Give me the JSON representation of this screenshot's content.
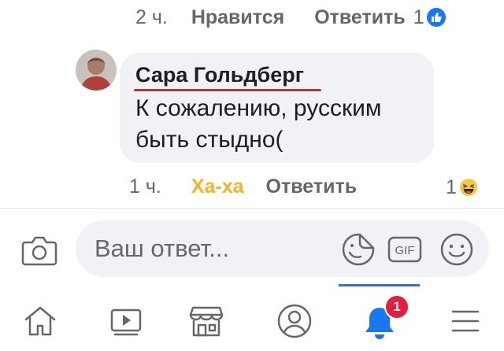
{
  "top_actions": {
    "time": "2 ч.",
    "like_label": "Нравится",
    "reply_label": "Ответить",
    "reaction_count": "1",
    "reaction_icon": "like-icon",
    "accent_color": "#1877f2"
  },
  "comment": {
    "author": "Сара Гольдберг",
    "text": "К сожалению, русским быть стыдно(",
    "avatar_icon": "avatar-photo"
  },
  "comment_actions": {
    "time": "1 ч.",
    "reaction_label": "Ха-ха",
    "reply_label": "Ответить",
    "reaction_count": "1",
    "reaction_icon": "haha-icon",
    "reaction_color": "#f7b125"
  },
  "reply_bar": {
    "placeholder": "Ваш ответ...",
    "camera_icon": "camera-icon",
    "sticker_icon": "sticker-icon",
    "gif_label": "GIF",
    "emoji_icon": "emoji-icon"
  },
  "bottom_nav": {
    "items": [
      "home-icon",
      "video-icon",
      "marketplace-icon",
      "profile-icon",
      "notifications-icon",
      "menu-icon"
    ],
    "active": "notifications-icon",
    "notification_count": "1",
    "badge_color": "#e41e3f"
  }
}
